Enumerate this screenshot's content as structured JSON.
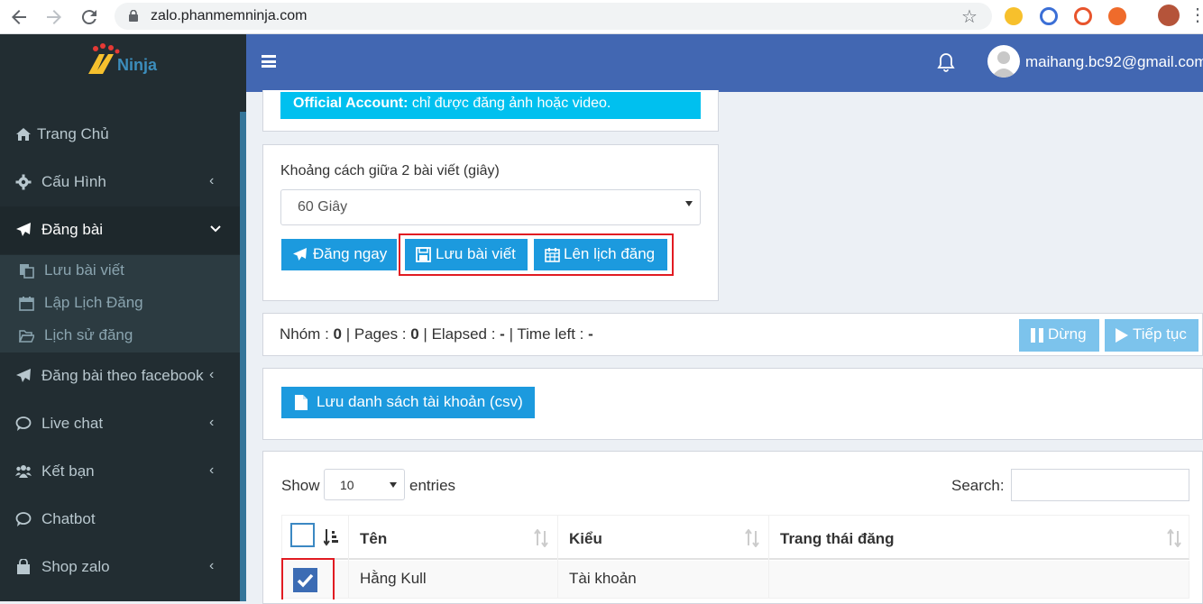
{
  "browser": {
    "url": "zalo.phanmemninja.com"
  },
  "sidebar": {
    "logo_text": "Ninja",
    "items": [
      {
        "label": "Trang Chủ",
        "icon": "home-icon"
      },
      {
        "label": "Cấu Hình",
        "icon": "gear-icon"
      },
      {
        "label": "Đăng bài",
        "icon": "paper-plane-icon"
      },
      {
        "label": "Đăng bài theo facebook",
        "icon": "paper-plane-icon"
      },
      {
        "label": "Live chat",
        "icon": "chat-bubble-icon"
      },
      {
        "label": "Kết bạn",
        "icon": "users-icon"
      },
      {
        "label": "Chatbot",
        "icon": "chat-bubble-icon"
      },
      {
        "label": "Shop zalo",
        "icon": "shopping-bag-icon"
      }
    ],
    "subitems": [
      {
        "label": "Lưu bài viết",
        "icon": "copy-icon"
      },
      {
        "label": "Lập Lịch Đăng",
        "icon": "calendar-icon"
      },
      {
        "label": "Lịch sử đăng",
        "icon": "folder-open-icon"
      }
    ]
  },
  "header": {
    "email": "maihang.bc92@gmail.com"
  },
  "main": {
    "banner_bold": "Official Account:",
    "banner_text": " chỉ được đăng ảnh hoặc video.",
    "interval_label": "Khoảng cách giữa 2 bài viết (giây)",
    "interval_value": "60 Giây",
    "btn_post_now": "Đăng ngay",
    "btn_save_post": "Lưu bài viết",
    "btn_schedule": "Lên lịch đăng",
    "stats": {
      "group_label": "Nhóm : ",
      "group_value": "0",
      "pages_label": " | Pages : ",
      "pages_value": "0",
      "elapsed_label": " | Elapsed : ",
      "elapsed_value": "-",
      "timeleft_label": " | Time left : ",
      "timeleft_value": "-"
    },
    "btn_stop": "Dừng",
    "btn_continue": "Tiếp tục",
    "btn_save_csv": "Lưu danh sách tài khoản (csv)",
    "table": {
      "show_label": "Show",
      "entries_value": "10",
      "entries_label": "entries",
      "search_label": "Search:",
      "columns": [
        "Tên",
        "Kiểu",
        "Trang thái đăng"
      ],
      "rows": [
        {
          "name": "Hằng Kull",
          "type": "Tài khoản",
          "status": "",
          "checked": true
        }
      ]
    }
  },
  "colors": {
    "header": "#4267b2",
    "sidebar": "#222d32",
    "button": "#1c9ade",
    "highlight": "#e11b22"
  }
}
